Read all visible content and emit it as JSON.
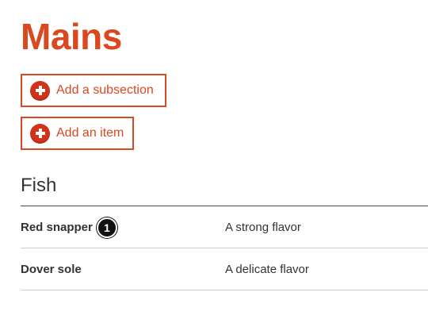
{
  "page": {
    "title": "Mains"
  },
  "actions": {
    "add_subsection_label": "Add a subsection",
    "add_item_label": "Add an item"
  },
  "section": {
    "heading": "Fish",
    "rows": [
      {
        "name": "Red snapper",
        "description": "A strong flavor",
        "marker": "1"
      },
      {
        "name": "Dover sole",
        "description": "A delicate flavor"
      }
    ]
  },
  "colors": {
    "accent": "#d9481f",
    "icon_fill": "#d0321a",
    "text": "#333333",
    "marker_bg": "#111111"
  }
}
